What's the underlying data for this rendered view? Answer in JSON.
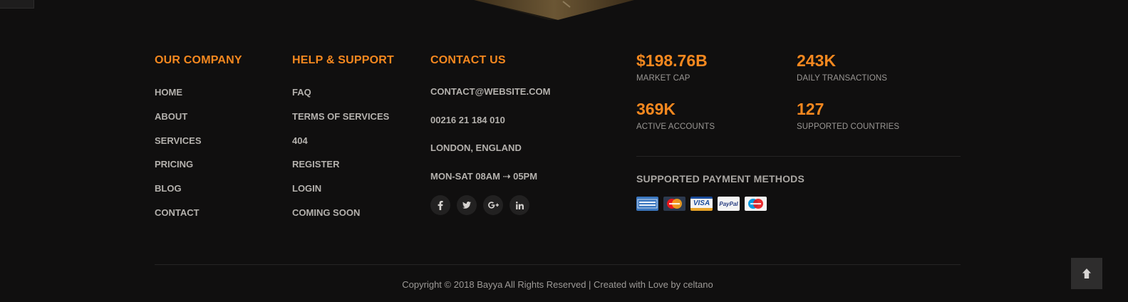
{
  "columns": {
    "company": {
      "title": "OUR COMPANY",
      "links": [
        "HOME",
        "ABOUT",
        "SERVICES",
        "PRICING",
        "BLOG",
        "CONTACT"
      ]
    },
    "support": {
      "title": "HELP & SUPPORT",
      "links": [
        "FAQ",
        "TERMS OF SERVICES",
        "404",
        "REGISTER",
        "LOGIN",
        "COMING SOON"
      ]
    },
    "contact": {
      "title": "CONTACT US",
      "lines": [
        "CONTACT@WEBSITE.COM",
        "00216 21 184 010",
        "LONDON, ENGLAND",
        "MON-SAT 08AM ⇢ 05PM"
      ],
      "socials": [
        "facebook-icon",
        "twitter-icon",
        "google-plus-icon",
        "linkedin-icon"
      ]
    }
  },
  "stats": [
    {
      "value": "$198.76B",
      "label": "MARKET CAP"
    },
    {
      "value": "243K",
      "label": "DAILY TRANSACTIONS"
    },
    {
      "value": "369K",
      "label": "ACTIVE ACCOUNTS"
    },
    {
      "value": "127",
      "label": "SUPPORTED COUNTRIES"
    }
  ],
  "payment": {
    "title": "SUPPORTED PAYMENT METHODS",
    "methods": [
      "american-express-icon",
      "mastercard-icon",
      "visa-icon",
      "paypal-icon",
      "maestro-icon"
    ],
    "visa_text": "VISA",
    "paypal_text": "PayPal"
  },
  "footer": {
    "copyright": "Copyright © 2018 Bayya All Rights Reserved | Created with Love by celtano"
  },
  "colors": {
    "accent": "#f5881f",
    "background": "#100f0f",
    "text": "#b4b1ad"
  }
}
